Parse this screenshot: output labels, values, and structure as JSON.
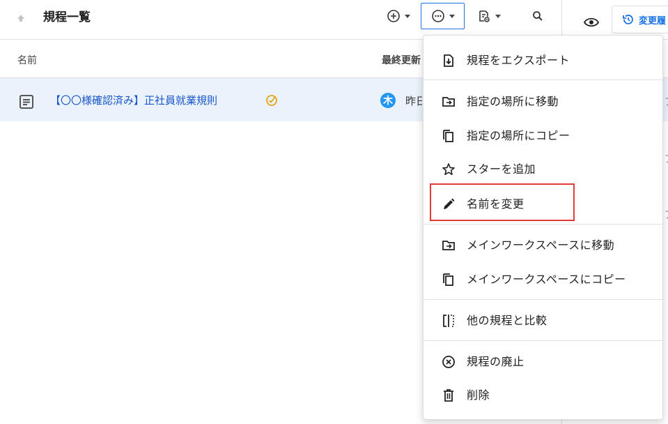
{
  "toolbar": {
    "title": "規程一覧",
    "history_label": "変更履"
  },
  "columns": {
    "name": "名前",
    "modified": "最終更新"
  },
  "row": {
    "title": "【〇〇様確認済み】正社員就業規則",
    "avatar_initial": "木",
    "modified": "昨日"
  },
  "edge_fragments": [
    "ア",
    "ア",
    "ア"
  ],
  "menu": {
    "items": [
      {
        "label": "規程をエクスポート",
        "icon": "export-icon"
      },
      {
        "label": "指定の場所に移動",
        "icon": "move-folder-icon"
      },
      {
        "label": "指定の場所にコピー",
        "icon": "copy-icon"
      },
      {
        "label": "スターを追加",
        "icon": "star-icon"
      },
      {
        "label": "名前を変更",
        "icon": "pencil-icon"
      },
      {
        "label": "メインワークスペースに移動",
        "icon": "move-folder-icon"
      },
      {
        "label": "メインワークスペースにコピー",
        "icon": "copy-icon"
      },
      {
        "label": "他の規程と比較",
        "icon": "compare-icon"
      },
      {
        "label": "規程の廃止",
        "icon": "cancel-circle-icon"
      },
      {
        "label": "削除",
        "icon": "trash-icon"
      }
    ],
    "highlighted_index": 4
  },
  "colors": {
    "accent": "#1a73e8",
    "row_selected": "#eaf2fc",
    "highlight_border": "#e53935",
    "avatar": "#2196f3",
    "badge": "#e6a317"
  }
}
